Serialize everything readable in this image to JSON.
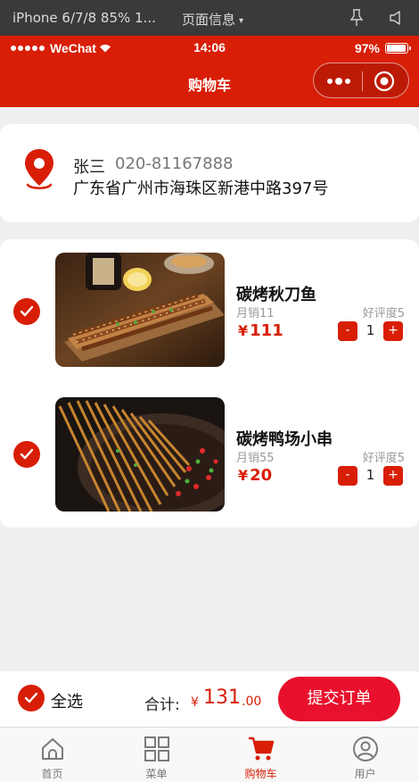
{
  "devtools": {
    "device": "iPhone 6/7/8 85% 1...",
    "page_info": "页面信息",
    "caret": "▾",
    "icons": [
      "pin-icon",
      "speaker-icon"
    ]
  },
  "status_bar": {
    "carrier": "WeChat",
    "time": "14:06",
    "battery": "97%",
    "battery_level": 0.97
  },
  "navbar": {
    "title": "购物车",
    "color": "#d81e06"
  },
  "address": {
    "name": "张三",
    "phone": "020-81167888",
    "address": "广东省广州市海珠区新港中路397号"
  },
  "cart": {
    "items": [
      {
        "name": "碳烤秋刀鱼",
        "sales": "月销11",
        "rating": "好评度5",
        "currency": "¥",
        "price": "111",
        "qty": "1",
        "minus": "-",
        "plus": "+",
        "checked": true
      },
      {
        "name": "碳烤鸭场小串",
        "sales": "月销55",
        "rating": "好评度5",
        "currency": "¥",
        "price": "20",
        "qty": "1",
        "minus": "-",
        "plus": "+",
        "checked": true
      }
    ]
  },
  "submit_bar": {
    "select_all": "全选",
    "total_label": "合计:",
    "currency": "¥",
    "total": "131",
    "cents": ".00",
    "submit": "提交订单"
  },
  "tabbar": {
    "tabs": [
      {
        "label": "首页",
        "icon": "home-icon",
        "active": false
      },
      {
        "label": "菜单",
        "icon": "grid-icon",
        "active": false
      },
      {
        "label": "购物车",
        "icon": "cart-icon",
        "active": true
      },
      {
        "label": "用户",
        "icon": "user-icon",
        "active": false
      }
    ]
  },
  "colors": {
    "accent": "#d81e06",
    "submit": "#e8102c"
  }
}
